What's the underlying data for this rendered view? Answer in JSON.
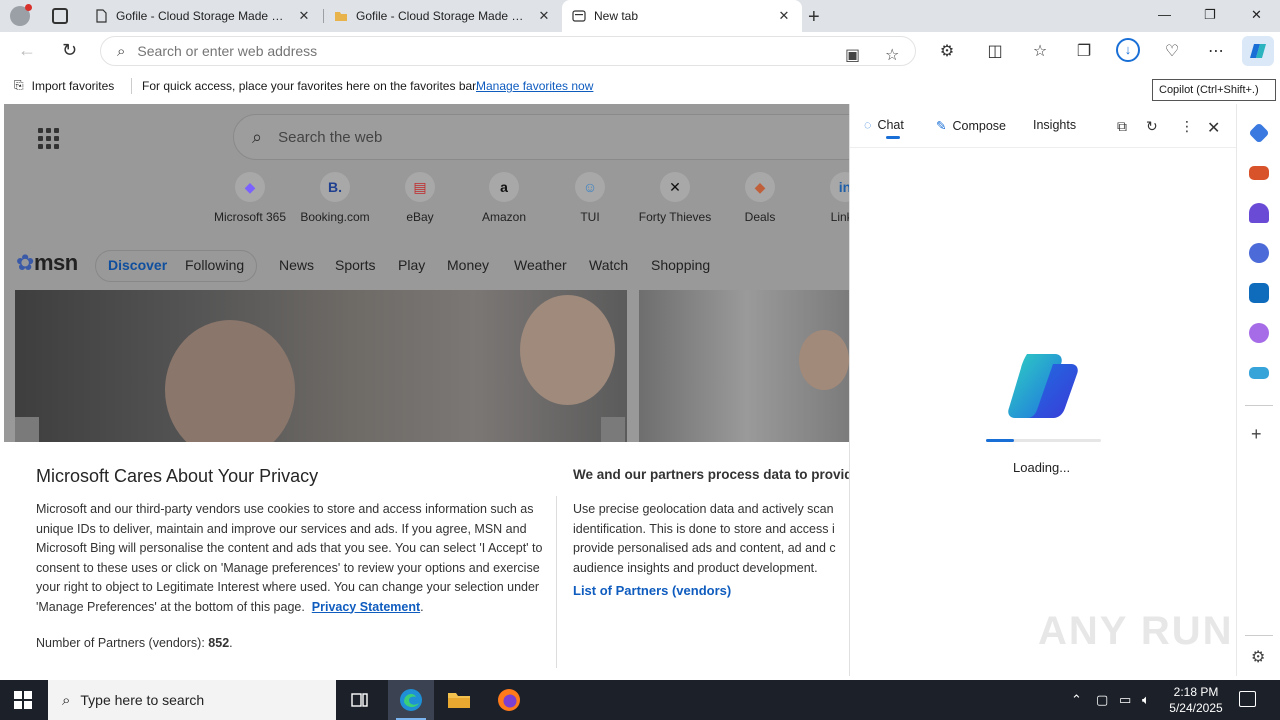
{
  "browser": {
    "tabs": [
      {
        "title": "Gofile - Cloud Storage Made Simple",
        "icon": "page-icon"
      },
      {
        "title": "Gofile - Cloud Storage Made Simple",
        "icon": "folder-icon"
      },
      {
        "title": "New tab",
        "icon": "newtab-icon"
      }
    ],
    "new_tab_symbol": "+",
    "close_symbol": "✕",
    "window_controls": {
      "minimize": "—",
      "restore": "❐",
      "close": "✕"
    }
  },
  "toolbar": {
    "address_placeholder": "Search or enter web address",
    "tooltip": "Copilot (Ctrl+Shift+.)"
  },
  "favorites_bar": {
    "import_label": "Import favorites",
    "hint": "For quick access, place your favorites here on the favorites bar.",
    "manage_link": "Manage favorites now"
  },
  "newtab": {
    "search_placeholder": "Search the web",
    "tiles": [
      {
        "label": "Microsoft 365",
        "glyph": "◆",
        "color": "#7b61ff"
      },
      {
        "label": "Booking.com",
        "glyph": "B.",
        "color": "#1f3f8f"
      },
      {
        "label": "eBay",
        "glyph": "▤",
        "color": "#c02a2a"
      },
      {
        "label": "Amazon",
        "glyph": "a",
        "color": "#111111"
      },
      {
        "label": "TUI",
        "glyph": "☺",
        "color": "#3b82c4"
      },
      {
        "label": "Forty Thieves",
        "glyph": "✕",
        "color": "#111111"
      },
      {
        "label": "Deals",
        "glyph": "◆",
        "color": "#c0603b"
      },
      {
        "label": "Linke",
        "glyph": "in",
        "color": "#1f5fa8"
      }
    ],
    "msn": {
      "logo": "msn",
      "tabs": [
        "Discover",
        "Following"
      ],
      "nav": [
        "News",
        "Sports",
        "Play",
        "Money",
        "Weather",
        "Watch",
        "Shopping"
      ]
    }
  },
  "privacy": {
    "title": "Microsoft Cares About Your Privacy",
    "body_1": "Microsoft and our third-party vendors use cookies to store and access information such as unique IDs to deliver, maintain and improve our services and ads. If you agree, MSN and Microsoft Bing will personalise the content and ads that you see. You can select 'I Accept' to consent to these uses or click on 'Manage preferences' to review your options and exercise your right to object to Legitimate Interest where used.  You can change your selection under 'Manage Preferences' at the bottom of this page.",
    "privacy_link": "Privacy Statement",
    "partners_label": "Number of Partners (vendors):",
    "partners_count": "852",
    "title_2": "We and our partners process data to provide",
    "body_2_lines": [
      "Use precise geolocation data and actively scan",
      "identification. This is done to store and access i",
      "provide personalised ads and content, ad and c",
      "audience insights and product development."
    ],
    "partners_link": "List of Partners (vendors)"
  },
  "copilot": {
    "tabs": [
      "Chat",
      "Compose",
      "Insights"
    ],
    "loading_text": "Loading...",
    "progress": 0.24,
    "watermark": "ANY RUN"
  },
  "taskbar": {
    "search_placeholder": "Type here to search",
    "time": "2:18 PM",
    "date": "5/24/2025"
  }
}
